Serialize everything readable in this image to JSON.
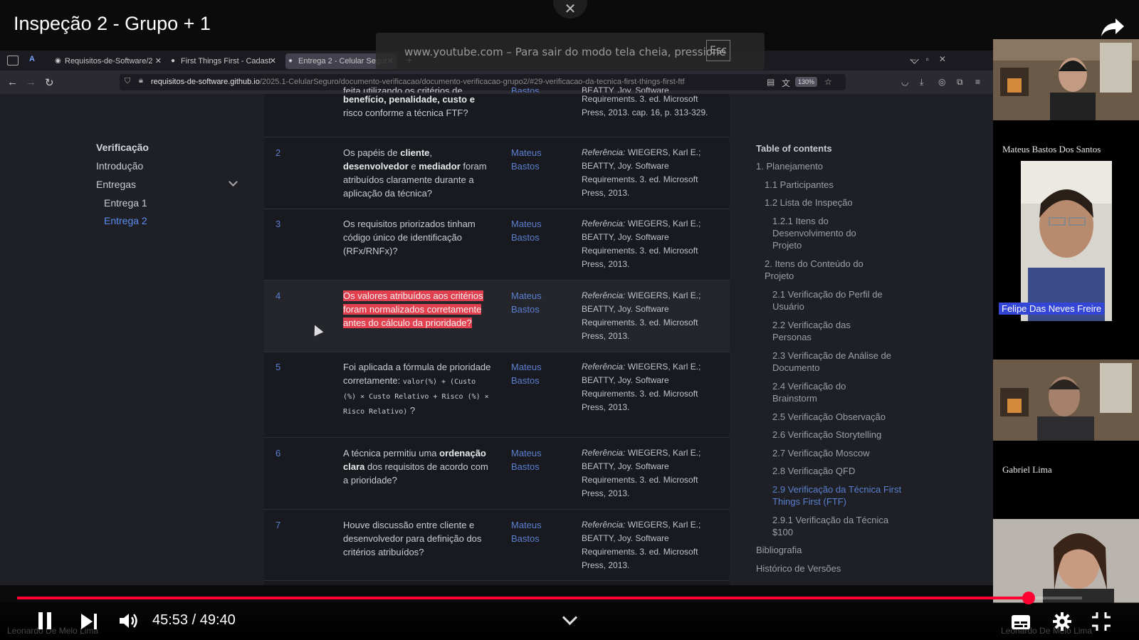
{
  "video": {
    "title": "Inspeção 2 - Grupo + 1",
    "fullscreen_hint": "www.youtube.com – Para sair do modo tela cheia, pressione",
    "esc_key": "Esc",
    "time": "45:53 / 49:40",
    "progress": 0.95,
    "watermark": "Leonardo De Melo Lima"
  },
  "browser": {
    "tabs": [
      {
        "label": "Requisitos-de-Software/2",
        "active": false
      },
      {
        "label": "First Things First - Cadast",
        "active": false
      },
      {
        "label": "Entrega 2 - Celular Segur",
        "active": true
      }
    ],
    "new_tab": "+",
    "url_host": "requisitos-de-software.github.io",
    "url_path": "/2025.1-CelularSeguro/documento-verificacao/documento-verificacao-grupo2/#29-verificacao-da-tecnica-first-things-first-ftf",
    "zoom": "130%"
  },
  "sidebar": {
    "title": "Verificação",
    "items": [
      "Introdução",
      "Entregas",
      "Entrega 1",
      "Entrega 2"
    ]
  },
  "table": {
    "partial_top": {
      "question_lines": [
        "feita utilizando os critérios de",
        "benefício, penalidade, custo e",
        "risco conforme a técnica FTF?"
      ],
      "author": "Bastos",
      "ref_lines": [
        "BEATTY, Joy. Software",
        "Requirements. 3. ed. Microsoft",
        "Press, 2013. cap. 16, p. 313-329."
      ]
    },
    "ref_prefix": "Referência:",
    "ref_rest": " WIEGERS, Karl E.; BEATTY, Joy. Software Requirements. 3. ed. Microsoft Press, 2013.",
    "author_name": "Mateus Bastos",
    "rows": [
      {
        "num": "2"
      },
      {
        "num": "3",
        "question": "Os requisitos priorizados tinham código único de identificação (RFx/RNFx)?"
      },
      {
        "num": "4",
        "question": "Os valores atribuídos aos critérios foram normalizados corretamente antes do cálculo da prioridade?"
      },
      {
        "num": "5",
        "question_start": "Foi aplicada a fórmula de prioridade corretamente:",
        "formula": "valor(%) + (Custo (%) × Custo Relativo + Risco (%) × Risco Relativo)",
        "question_end": " ?"
      },
      {
        "num": "6"
      },
      {
        "num": "7",
        "question": "Houve discussão entre cliente e desenvolvedor para definição dos critérios atribuídos?"
      }
    ],
    "row2": {
      "p1": "Os papéis de ",
      "b1": "cliente",
      "p2": ", ",
      "b2": "desenvolvedor",
      "p3": " e ",
      "b3": "mediador",
      "p4": " foram atribuídos claramente durante a aplicação da técnica?"
    },
    "row6": {
      "p1": "A técnica permitiu uma ",
      "b1": "ordenação clara",
      "p2": " dos requisitos de acordo com a prioridade?"
    }
  },
  "toc": {
    "title": "Table of contents",
    "items": [
      "1. Planejamento",
      "1.1 Participantes",
      "1.2 Lista de Inspeção",
      "1.2.1 Itens do Desenvolvimento do Projeto",
      "2. Itens do Conteúdo do Projeto",
      "2.1 Verificação do Perfil de Usuário",
      "2.2 Verificação das Personas",
      "2.3 Verificação de Análise de Documento",
      "2.4 Verificação do Brainstorm",
      "2.5 Verificação Observação",
      "2.6 Verificação Storytelling",
      "2.7 Verificação Moscow",
      "2.8 Verificação QFD",
      "2.9 Verificação da Técnica First Things First (FTF)",
      "2.9.1 Verificação da Técnica $100",
      "Bibliografia",
      "Histórico de Versões"
    ]
  },
  "participants": {
    "mateus": "Mateus Bastos Dos Santos",
    "felipe": "Felipe Das Neves Freire",
    "gabriel": "Gabriel Lima"
  },
  "colors": {
    "accent": "#ff0033",
    "link": "#5b7fd1",
    "highlight": "#e2404f"
  }
}
